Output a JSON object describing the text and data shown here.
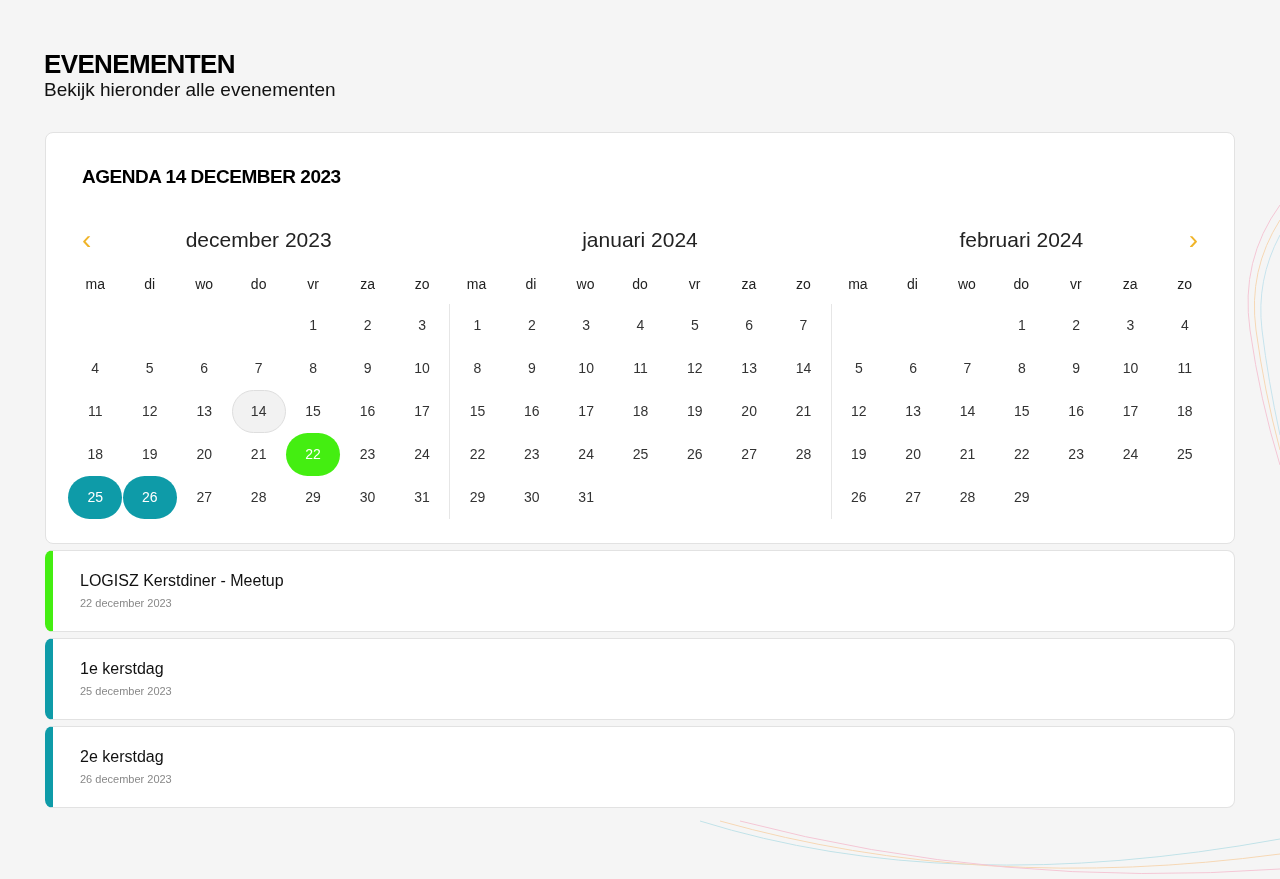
{
  "page": {
    "title": "EVENEMENTEN",
    "subtitle": "Bekijk hieronder alle evenementen"
  },
  "calendar": {
    "title": "AGENDA 14 DECEMBER 2023",
    "prev": "‹",
    "next": "›",
    "months": [
      {
        "title": "december 2023",
        "weekdays": [
          "ma",
          "di",
          "wo",
          "do",
          "vr",
          "za",
          "zo"
        ],
        "weeks": [
          [
            {
              "day": "1",
              "kind": "plain"
            },
            {
              "day": "2",
              "kind": "plain"
            },
            {
              "day": "3",
              "kind": "plain"
            }
          ],
          [
            {
              "day": "4",
              "kind": "plain"
            },
            {
              "day": "5",
              "kind": "plain"
            },
            {
              "day": "6",
              "kind": "plain"
            },
            {
              "day": "7",
              "kind": "plain"
            },
            {
              "day": "8",
              "kind": "plain"
            },
            {
              "day": "9",
              "kind": "plain"
            },
            {
              "day": "10",
              "kind": "plain"
            }
          ],
          [
            {
              "day": "11",
              "kind": "plain"
            },
            {
              "day": "12",
              "kind": "plain"
            },
            {
              "day": "13",
              "kind": "plain"
            },
            {
              "day": "14",
              "kind": "today"
            },
            {
              "day": "15",
              "kind": "plain"
            },
            {
              "day": "16",
              "kind": "plain"
            },
            {
              "day": "17",
              "kind": "plain"
            }
          ],
          [
            {
              "day": "18",
              "kind": "plain"
            },
            {
              "day": "19",
              "kind": "plain"
            },
            {
              "day": "20",
              "kind": "plain"
            },
            {
              "day": "21",
              "kind": "plain"
            },
            {
              "day": "22",
              "kind": "event",
              "color": "#44ee11"
            },
            {
              "day": "23",
              "kind": "plain"
            },
            {
              "day": "24",
              "kind": "plain"
            }
          ],
          [
            {
              "day": "25",
              "kind": "event",
              "color": "#0e9ba8"
            },
            {
              "day": "26",
              "kind": "event",
              "color": "#0e9ba8"
            },
            {
              "day": "27",
              "kind": "plain"
            },
            {
              "day": "28",
              "kind": "plain"
            },
            {
              "day": "29",
              "kind": "plain"
            },
            {
              "day": "30",
              "kind": "plain"
            },
            {
              "day": "31",
              "kind": "plain"
            }
          ]
        ]
      },
      {
        "title": "januari 2024",
        "weekdays": [
          "ma",
          "di",
          "wo",
          "do",
          "vr",
          "za",
          "zo"
        ],
        "weeks": [
          [
            {
              "day": "1",
              "kind": "plain"
            },
            {
              "day": "2",
              "kind": "plain"
            },
            {
              "day": "3",
              "kind": "plain"
            },
            {
              "day": "4",
              "kind": "plain"
            },
            {
              "day": "5",
              "kind": "plain"
            },
            {
              "day": "6",
              "kind": "plain"
            },
            {
              "day": "7",
              "kind": "plain"
            }
          ],
          [
            {
              "day": "8",
              "kind": "plain"
            },
            {
              "day": "9",
              "kind": "plain"
            },
            {
              "day": "10",
              "kind": "plain"
            },
            {
              "day": "11",
              "kind": "plain"
            },
            {
              "day": "12",
              "kind": "plain"
            },
            {
              "day": "13",
              "kind": "plain"
            },
            {
              "day": "14",
              "kind": "plain"
            }
          ],
          [
            {
              "day": "15",
              "kind": "plain"
            },
            {
              "day": "16",
              "kind": "plain"
            },
            {
              "day": "17",
              "kind": "plain"
            },
            {
              "day": "18",
              "kind": "plain"
            },
            {
              "day": "19",
              "kind": "plain"
            },
            {
              "day": "20",
              "kind": "plain"
            },
            {
              "day": "21",
              "kind": "plain"
            }
          ],
          [
            {
              "day": "22",
              "kind": "plain"
            },
            {
              "day": "23",
              "kind": "plain"
            },
            {
              "day": "24",
              "kind": "plain"
            },
            {
              "day": "25",
              "kind": "plain"
            },
            {
              "day": "26",
              "kind": "plain"
            },
            {
              "day": "27",
              "kind": "plain"
            },
            {
              "day": "28",
              "kind": "plain"
            }
          ],
          [
            {
              "day": "29",
              "kind": "plain"
            },
            {
              "day": "30",
              "kind": "plain"
            },
            {
              "day": "31",
              "kind": "plain"
            }
          ]
        ]
      },
      {
        "title": "februari 2024",
        "weekdays": [
          "ma",
          "di",
          "wo",
          "do",
          "vr",
          "za",
          "zo"
        ],
        "weeks": [
          [
            {
              "day": "1",
              "kind": "plain"
            },
            {
              "day": "2",
              "kind": "plain"
            },
            {
              "day": "3",
              "kind": "plain"
            },
            {
              "day": "4",
              "kind": "plain"
            }
          ],
          [
            {
              "day": "5",
              "kind": "plain"
            },
            {
              "day": "6",
              "kind": "plain"
            },
            {
              "day": "7",
              "kind": "plain"
            },
            {
              "day": "8",
              "kind": "plain"
            },
            {
              "day": "9",
              "kind": "plain"
            },
            {
              "day": "10",
              "kind": "plain"
            },
            {
              "day": "11",
              "kind": "plain"
            }
          ],
          [
            {
              "day": "12",
              "kind": "plain"
            },
            {
              "day": "13",
              "kind": "plain"
            },
            {
              "day": "14",
              "kind": "plain"
            },
            {
              "day": "15",
              "kind": "plain"
            },
            {
              "day": "16",
              "kind": "plain"
            },
            {
              "day": "17",
              "kind": "plain"
            },
            {
              "day": "18",
              "kind": "plain"
            }
          ],
          [
            {
              "day": "19",
              "kind": "plain"
            },
            {
              "day": "20",
              "kind": "plain"
            },
            {
              "day": "21",
              "kind": "plain"
            },
            {
              "day": "22",
              "kind": "plain"
            },
            {
              "day": "23",
              "kind": "plain"
            },
            {
              "day": "24",
              "kind": "plain"
            },
            {
              "day": "25",
              "kind": "plain"
            }
          ],
          [
            {
              "day": "26",
              "kind": "plain"
            },
            {
              "day": "27",
              "kind": "plain"
            },
            {
              "day": "28",
              "kind": "plain"
            },
            {
              "day": "29",
              "kind": "plain"
            }
          ]
        ]
      }
    ]
  },
  "events": [
    {
      "title": "LOGISZ Kerstdiner - Meetup",
      "date": "22 december 2023",
      "color": "#44ee11"
    },
    {
      "title": "1e kerstdag",
      "date": "25 december 2023",
      "color": "#0e9ba8"
    },
    {
      "title": "2e kerstdag",
      "date": "26 december 2023",
      "color": "#0e9ba8"
    }
  ]
}
